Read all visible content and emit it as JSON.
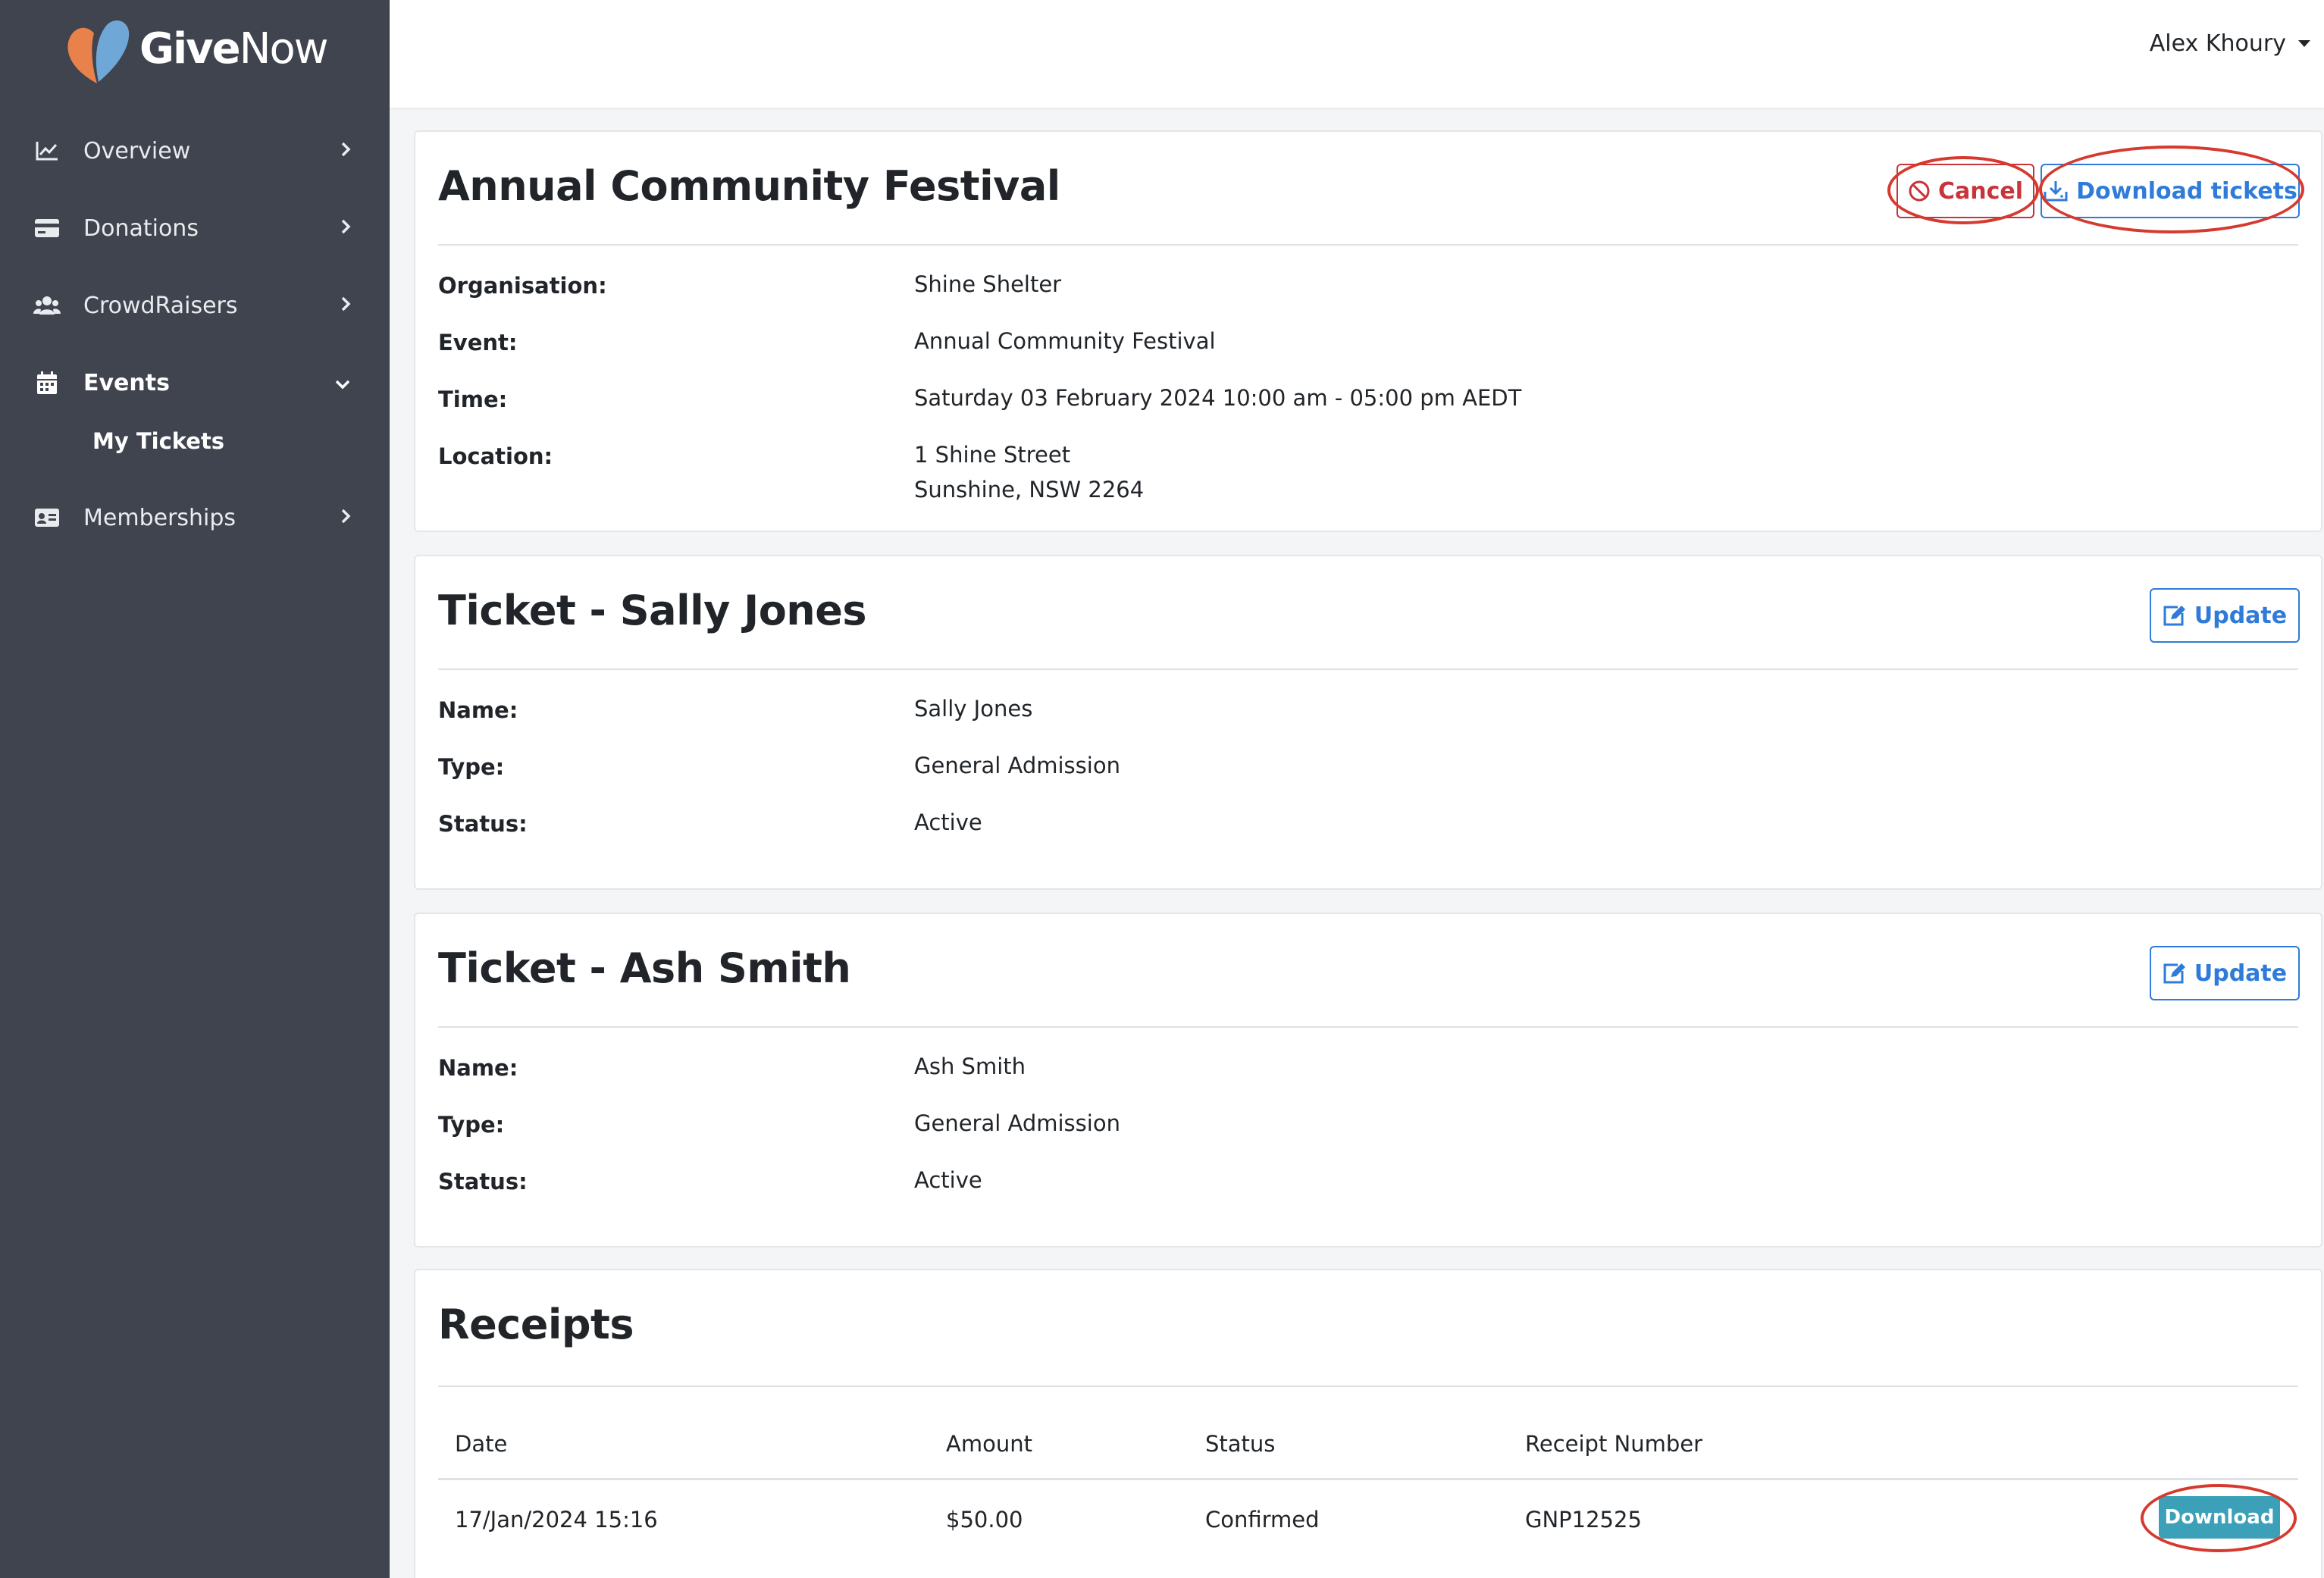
{
  "brand": {
    "name_bold": "Give",
    "name_regular": "Now"
  },
  "user": {
    "name": "Alex Khoury"
  },
  "sidebar": {
    "items": [
      {
        "label": "Overview",
        "icon": "chart-line-icon"
      },
      {
        "label": "Donations",
        "icon": "credit-card-icon"
      },
      {
        "label": "CrowdRaisers",
        "icon": "users-icon"
      },
      {
        "label": "Events",
        "icon": "calendar-icon",
        "expanded": true
      },
      {
        "label": "Memberships",
        "icon": "id-card-icon"
      }
    ],
    "sub_items": [
      {
        "label": "My Tickets"
      }
    ]
  },
  "event": {
    "title": "Annual Community Festival",
    "cancel_label": "Cancel",
    "download_tickets_label": "Download tickets",
    "labels": {
      "organisation": "Organisation:",
      "event": "Event:",
      "time": "Time:",
      "location": "Location:"
    },
    "values": {
      "organisation": "Shine Shelter",
      "event": "Annual Community Festival",
      "time": "Saturday 03 February 2024 10:00 am - 05:00 pm AEDT",
      "location_line1": "1 Shine Street",
      "location_line2": "Sunshine, NSW 2264"
    }
  },
  "tickets": [
    {
      "title": "Ticket - Sally Jones",
      "update_label": "Update",
      "labels": {
        "name": "Name:",
        "type": "Type:",
        "status": "Status:"
      },
      "values": {
        "name": "Sally Jones",
        "type": "General Admission",
        "status": "Active"
      }
    },
    {
      "title": "Ticket - Ash Smith",
      "update_label": "Update",
      "labels": {
        "name": "Name:",
        "type": "Type:",
        "status": "Status:"
      },
      "values": {
        "name": "Ash Smith",
        "type": "General Admission",
        "status": "Active"
      }
    }
  ],
  "receipts": {
    "title": "Receipts",
    "columns": [
      "Date",
      "Amount",
      "Status",
      "Receipt Number"
    ],
    "rows": [
      {
        "date": "17/Jan/2024 15:16",
        "amount": "$50.00",
        "status": "Confirmed",
        "receipt_number": "GNP12525",
        "action_label": "Download"
      }
    ]
  },
  "colors": {
    "sidebar": "#40444f",
    "primary": "#2f7bd9",
    "danger": "#c7343a",
    "download": "#3ba0b8",
    "annotation": "#d63a2f"
  }
}
